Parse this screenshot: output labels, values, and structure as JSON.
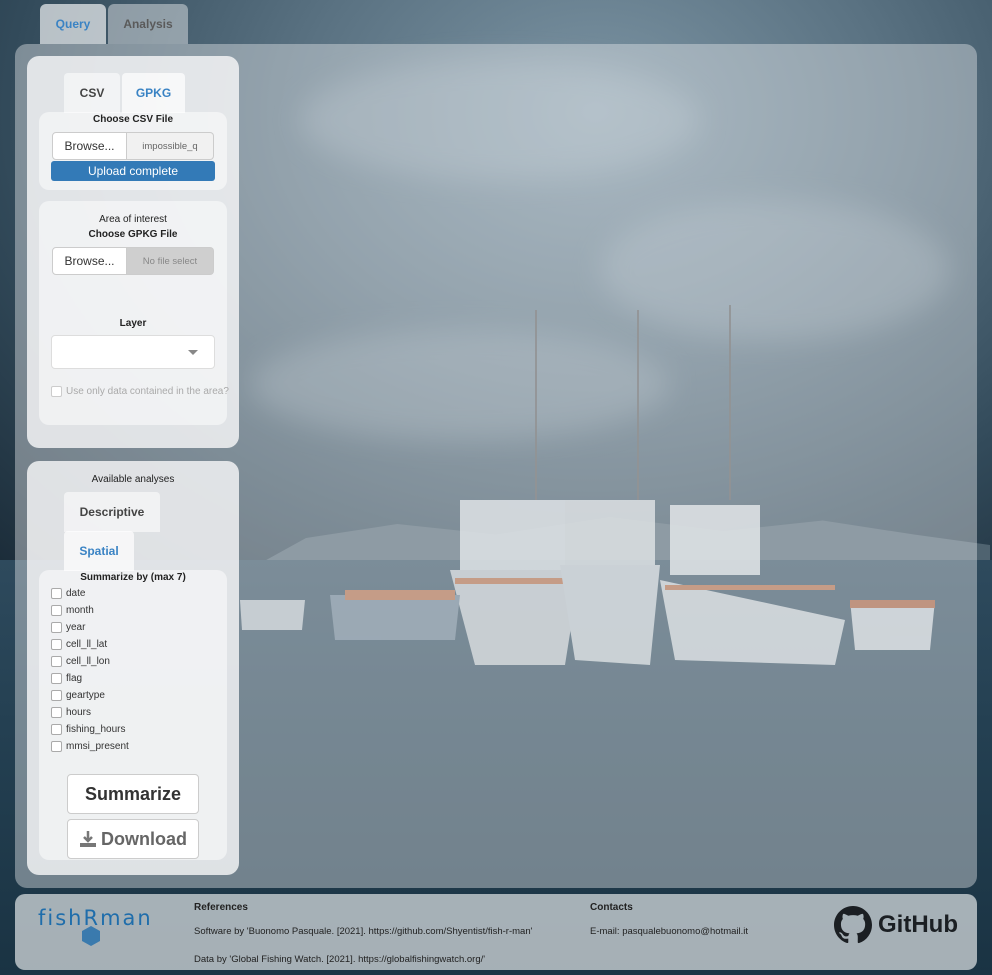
{
  "tabs": {
    "query": "Query",
    "analysis": "Analysis"
  },
  "upload": {
    "tab_csv": "CSV",
    "tab_gpkg": "GPKG",
    "csv_label": "Choose CSV File",
    "browse": "Browse...",
    "csv_filename": "impossible_q",
    "progress_text": "Upload complete",
    "progress": 1.0
  },
  "area": {
    "title": "Area of interest",
    "gpkg_label": "Choose GPKG File",
    "browse": "Browse...",
    "gpkg_placeholder": "No file select",
    "layer_label": "Layer",
    "layer_value": "",
    "checkbox_label": "Use only data contained in the area?"
  },
  "analyses": {
    "title": "Available analyses",
    "tab_descriptive": "Descriptive",
    "tab_spatial": "Spatial",
    "summarize_label": "Summarize by (max 7)",
    "fields": [
      "date",
      "month",
      "year",
      "cell_ll_lat",
      "cell_ll_lon",
      "flag",
      "geartype",
      "hours",
      "fishing_hours",
      "mmsi_present"
    ],
    "summarize_button": "Summarize",
    "download_button": "Download"
  },
  "footer": {
    "logo": "fishRman",
    "references_title": "References",
    "ref_software": "Software by 'Buonomo Pasquale. [2021]. https://github.com/Shyentist/fish-r-man'",
    "ref_data": "Data by 'Global Fishing Watch. [2021]. https://globalfishingwatch.org/'",
    "contacts_title": "Contacts",
    "email": "E-mail: pasqualebuonomo@hotmail.it",
    "github": "GitHub"
  },
  "colors": {
    "accent": "#337ab7",
    "tab_active": "#3a83c4"
  }
}
